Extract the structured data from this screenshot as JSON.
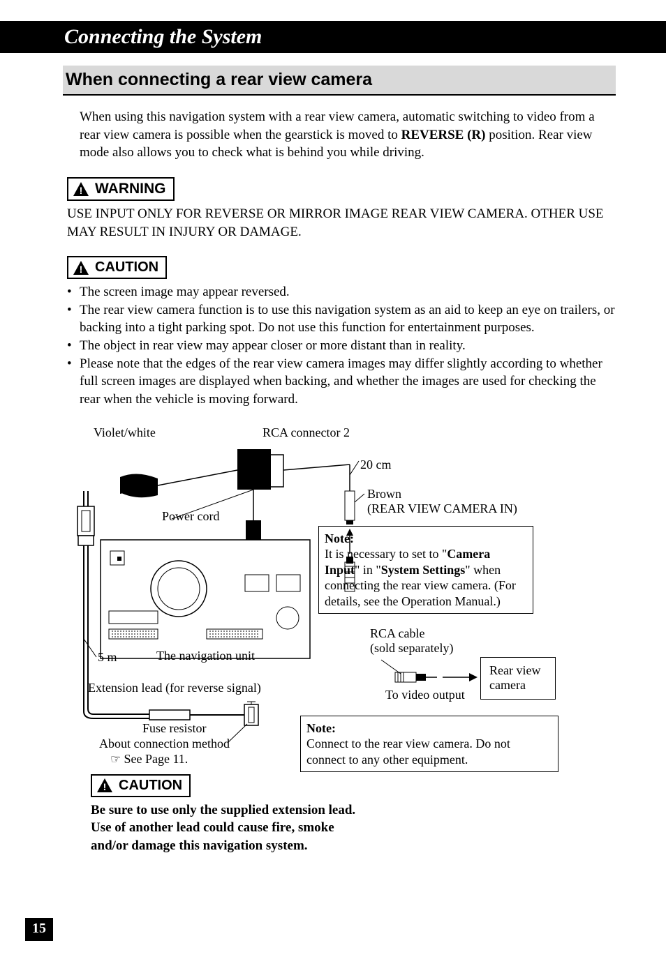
{
  "header": {
    "title": "Connecting the System"
  },
  "subsection": {
    "title": "When connecting a rear view camera"
  },
  "intro": {
    "p1_a": "When using this navigation system with a rear view camera, automatic switching to video from a rear view camera is possible when the gearstick is moved to ",
    "p1_bold": "REVERSE (R)",
    "p1_b": " position. Rear view mode also allows you to check what is behind you while driving."
  },
  "warning": {
    "label": "WARNING",
    "text": "USE INPUT ONLY FOR REVERSE OR MIRROR IMAGE REAR VIEW CAMERA. OTHER USE MAY RESULT IN INJURY OR DAMAGE."
  },
  "caution1": {
    "label": "CAUTION",
    "items": [
      "The screen image may appear reversed.",
      "The rear view camera function is to use this navigation system as an aid to keep an eye on trailers, or backing into a tight parking spot. Do not use this function for entertainment purposes.",
      "The object in rear view may appear closer or more distant than in reality.",
      "Please note that the edges of the rear view camera images may differ slightly according to whether full screen images are displayed when backing, and whether the images are used for checking the rear when the vehicle is moving forward."
    ]
  },
  "diagram": {
    "violet_white": "Violet/white",
    "rca_connector": "RCA connector 2",
    "cm20": "20 cm",
    "brown": "Brown",
    "rear_in": "(REAR VIEW CAMERA IN)",
    "power_cord": "Power cord",
    "nav_unit": "The navigation unit",
    "m5": "5 m",
    "extension_lead": "Extension lead (for reverse signal)",
    "fuse_resistor": "Fuse resistor",
    "about_connection": "About connection method",
    "see_page": "See Page 11.",
    "rca_cable": "RCA cable",
    "sold_separately": "(sold separately)",
    "to_video_output": "To video output",
    "rear_view_camera": "Rear view camera",
    "note_label": "Note:",
    "note1_a": "It is necessary to set to \"",
    "note1_b1": "Camera Input",
    "note1_c": "\" in \"",
    "note1_b2": "System Settings",
    "note1_d": "\" when connecting the rear view camera. (For details, see the Operation Manual.)",
    "note2": "Connect to the rear view camera. Do not connect to any other equipment."
  },
  "caution2": {
    "label": "CAUTION",
    "text": "Be sure to use only the supplied extension lead. Use of another lead could cause fire, smoke and/or damage this navigation system."
  },
  "page": {
    "number": "15"
  }
}
